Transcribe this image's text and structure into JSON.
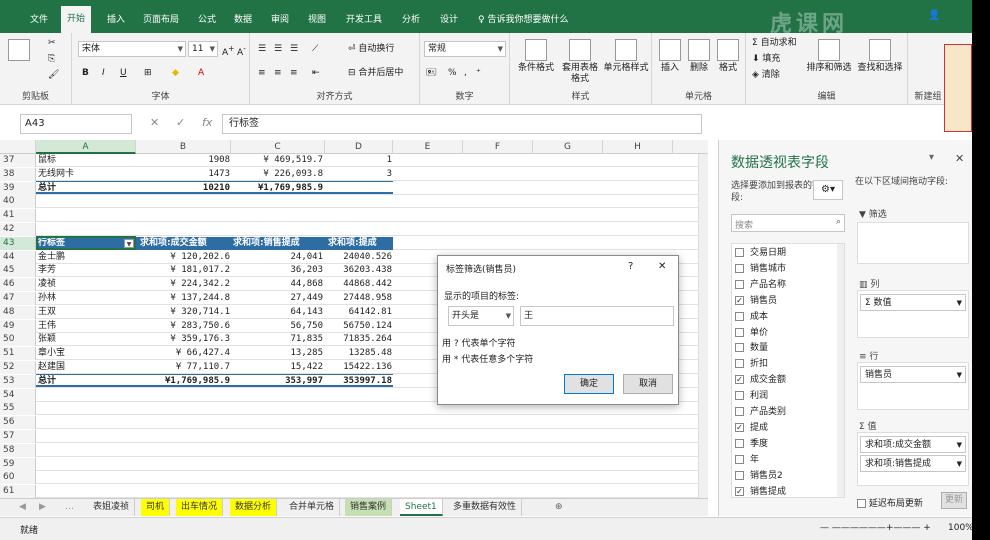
{
  "ribbon_tabs": [
    "文件",
    "开始",
    "插入",
    "页面布局",
    "公式",
    "数据",
    "审阅",
    "视图",
    "开发工具",
    "分析",
    "设计"
  ],
  "tell_me": "告诉我你想要做什么",
  "clipboard": {
    "label": "剪贴板"
  },
  "font": {
    "name": "宋体",
    "size": "11",
    "label": "字体",
    "bold": "B",
    "italic": "I",
    "underline": "U"
  },
  "alignment": {
    "wrap": "自动换行",
    "merge": "合并后居中",
    "label": "对齐方式"
  },
  "number": {
    "format": "常规",
    "label": "数字",
    "percent": "%"
  },
  "styles": {
    "cond": "条件格式",
    "table": "套用表格格式",
    "cell": "单元格样式",
    "label": "样式"
  },
  "cells": {
    "insert": "插入",
    "delete": "删除",
    "format": "格式",
    "label": "单元格"
  },
  "editing": {
    "sum": "自动求和",
    "fill": "填充",
    "clear": "清除",
    "sort": "排序和筛选",
    "find": "查找和选择",
    "label": "编辑"
  },
  "new_group": {
    "label": "新建组"
  },
  "name_box": "A43",
  "formula": "行标签",
  "columns": [
    "A",
    "B",
    "C",
    "D",
    "E",
    "F",
    "G",
    "H"
  ],
  "rows": [
    {
      "n": "37",
      "cells": [
        "鼠标",
        "1908",
        "¥    469,519.7",
        "1"
      ]
    },
    {
      "n": "38",
      "cells": [
        "无线网卡",
        "1473",
        "¥    226,093.8",
        "3"
      ]
    },
    {
      "n": "39",
      "cells": [
        "总计",
        "10210",
        "¥1,769,985.9",
        ""
      ],
      "type": "total"
    },
    {
      "n": "40",
      "cells": [
        "",
        "",
        "",
        ""
      ]
    },
    {
      "n": "41",
      "cells": [
        "",
        "",
        "",
        ""
      ]
    },
    {
      "n": "42",
      "cells": [
        "",
        "",
        "",
        ""
      ]
    },
    {
      "n": "43",
      "cells": [
        "行标签",
        "求和项:成交金额",
        "求和项:销售提成",
        "求和项:提成"
      ],
      "type": "header"
    },
    {
      "n": "44",
      "cells": [
        "金士鹏",
        "¥    120,202.6",
        "24,041",
        "24040.526"
      ]
    },
    {
      "n": "45",
      "cells": [
        "李芳",
        "¥    181,017.2",
        "36,203",
        "36203.438"
      ]
    },
    {
      "n": "46",
      "cells": [
        "凌祯",
        "¥    224,342.2",
        "44,868",
        "44868.442"
      ]
    },
    {
      "n": "47",
      "cells": [
        "孙林",
        "¥    137,244.8",
        "27,449",
        "27448.958"
      ]
    },
    {
      "n": "48",
      "cells": [
        "王双",
        "¥    320,714.1",
        "64,143",
        "64142.81"
      ]
    },
    {
      "n": "49",
      "cells": [
        "王伟",
        "¥    283,750.6",
        "56,750",
        "56750.124"
      ]
    },
    {
      "n": "50",
      "cells": [
        "张颖",
        "¥    359,176.3",
        "71,835",
        "71835.264"
      ]
    },
    {
      "n": "51",
      "cells": [
        "章小宝",
        "¥     66,427.4",
        "13,285",
        "13285.48"
      ]
    },
    {
      "n": "52",
      "cells": [
        "赵建国",
        "¥     77,110.7",
        "15,422",
        "15422.136"
      ]
    },
    {
      "n": "53",
      "cells": [
        "总计",
        "¥1,769,985.9",
        "353,997",
        "353997.18"
      ],
      "type": "total"
    },
    {
      "n": "54",
      "cells": [
        "",
        "",
        "",
        ""
      ]
    },
    {
      "n": "55",
      "cells": [
        "",
        "",
        "",
        ""
      ]
    },
    {
      "n": "56",
      "cells": [
        "",
        "",
        "",
        ""
      ]
    },
    {
      "n": "57",
      "cells": [
        "",
        "",
        "",
        ""
      ]
    },
    {
      "n": "58",
      "cells": [
        "",
        "",
        "",
        ""
      ]
    },
    {
      "n": "59",
      "cells": [
        "",
        "",
        "",
        ""
      ]
    },
    {
      "n": "60",
      "cells": [
        "",
        "",
        "",
        ""
      ]
    },
    {
      "n": "61",
      "cells": [
        "",
        "",
        "",
        ""
      ]
    }
  ],
  "sheet_tabs": [
    {
      "label": "表姐凌祯",
      "style": ""
    },
    {
      "label": "司机",
      "style": "yellow"
    },
    {
      "label": "出车情况",
      "style": "yellow"
    },
    {
      "label": "数据分析",
      "style": "yellow"
    },
    {
      "label": "合并单元格",
      "style": ""
    },
    {
      "label": "销售案例",
      "style": "green"
    },
    {
      "label": "Sheet1",
      "style": "active"
    },
    {
      "label": "多重数据有效性",
      "style": ""
    }
  ],
  "status": {
    "ready": "就绪",
    "zoom": "100%"
  },
  "pivot": {
    "title": "数据透视表字段",
    "choose": "选择要添加到报表的字段:",
    "drag": "在以下区域间拖动字段:",
    "search_placeholder": "搜索",
    "fields": [
      {
        "name": "交易日期",
        "checked": false
      },
      {
        "name": "销售城市",
        "checked": false
      },
      {
        "name": "产品名称",
        "checked": false
      },
      {
        "name": "销售员",
        "checked": true
      },
      {
        "name": "成本",
        "checked": false
      },
      {
        "name": "单价",
        "checked": false
      },
      {
        "name": "数量",
        "checked": false
      },
      {
        "name": "折扣",
        "checked": false
      },
      {
        "name": "成交金额",
        "checked": true
      },
      {
        "name": "利润",
        "checked": false
      },
      {
        "name": "产品类别",
        "checked": false
      },
      {
        "name": "提成",
        "checked": true
      },
      {
        "name": "季度",
        "checked": false
      },
      {
        "name": "年",
        "checked": false
      },
      {
        "name": "销售员2",
        "checked": false
      },
      {
        "name": "销售提成",
        "checked": true
      }
    ],
    "filter_label": "筛选",
    "columns_label": "列",
    "columns_item": "Σ 数值",
    "rows_label": "行",
    "rows_item": "销售员",
    "values_label": "Σ 值",
    "values_items": [
      "求和项:成交金额",
      "求和项:销售提成"
    ],
    "defer": "延迟布局更新",
    "update": "更新"
  },
  "dialog": {
    "title": "标签筛选(销售员)",
    "help": "?",
    "close": "✕",
    "prompt": "显示的项目的标签:",
    "operator": "开头是",
    "value": "王",
    "hint1": "用 ? 代表单个字符",
    "hint2": "用 * 代表任意多个字符",
    "ok": "确定",
    "cancel": "取消"
  },
  "watermark": "虎课网"
}
